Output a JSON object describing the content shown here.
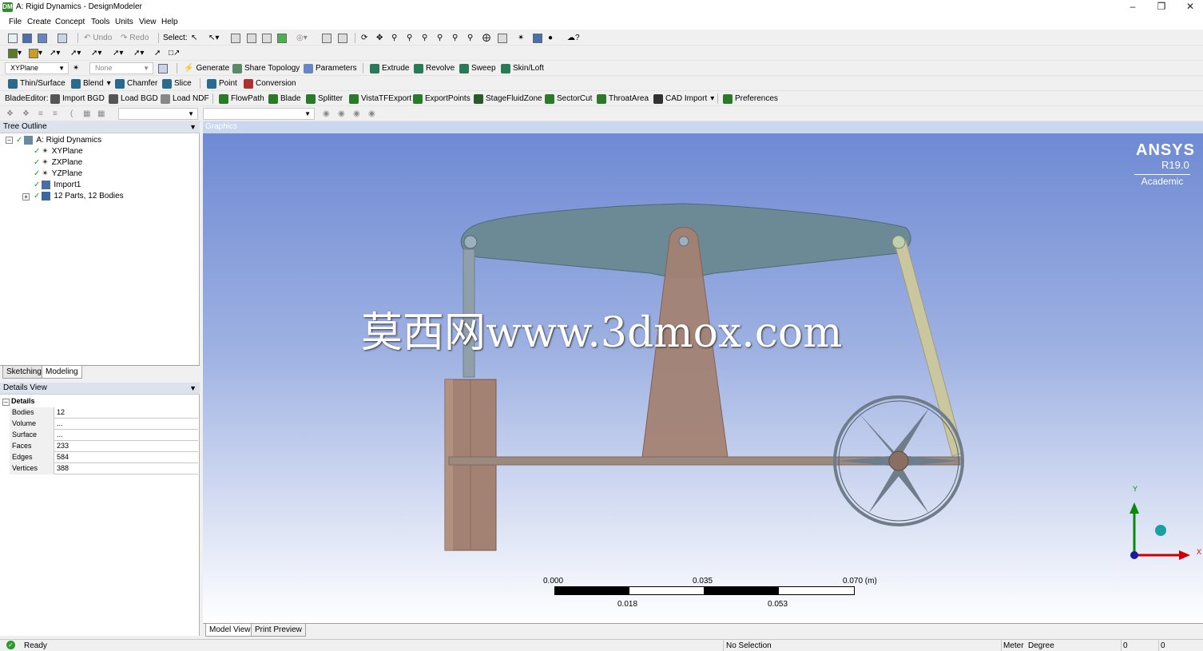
{
  "window": {
    "title": "A: Rigid Dynamics - DesignModeler",
    "app_icon": "DM"
  },
  "menu": [
    "File",
    "Create",
    "Concept",
    "Tools",
    "Units",
    "View",
    "Help"
  ],
  "toolbar1": {
    "undo": "Undo",
    "redo": "Redo",
    "select": "Select:"
  },
  "toolbar3": {
    "plane": "XYPlane",
    "sketch": "None",
    "generate": "Generate",
    "share_topology": "Share Topology",
    "parameters": "Parameters",
    "extrude": "Extrude",
    "revolve": "Revolve",
    "sweep": "Sweep",
    "skin_loft": "Skin/Loft"
  },
  "toolbar4": {
    "thin_surface": "Thin/Surface",
    "blend": "Blend",
    "chamfer": "Chamfer",
    "slice": "Slice",
    "point": "Point",
    "conversion": "Conversion"
  },
  "toolbar5": {
    "blade_editor": "BladeEditor:",
    "import_bgd": "Import BGD",
    "load_bgd": "Load BGD",
    "load_ndf": "Load NDF",
    "flowpath": "FlowPath",
    "blade": "Blade",
    "splitter": "Splitter",
    "vista_tf_export": "VistaTFExport",
    "export_points": "ExportPoints",
    "stage_fluid_zone": "StageFluidZone",
    "sector_cut": "SectorCut",
    "throat_area": "ThroatArea",
    "cad_import": "CAD Import",
    "preferences": "Preferences"
  },
  "tree_outline": {
    "title": "Tree Outline",
    "root": "A: Rigid Dynamics",
    "items": [
      "XYPlane",
      "ZXPlane",
      "YZPlane",
      "Import1",
      "12 Parts, 12 Bodies"
    ]
  },
  "panel_tabs": [
    "Sketching",
    "Modeling"
  ],
  "details_view": {
    "title": "Details View",
    "group": "Details",
    "rows": [
      {
        "k": "Bodies",
        "v": "12"
      },
      {
        "k": "Volume",
        "v": "..."
      },
      {
        "k": "Surface Area",
        "v": "..."
      },
      {
        "k": "Faces",
        "v": "233"
      },
      {
        "k": "Edges",
        "v": "584"
      },
      {
        "k": "Vertices",
        "v": "388"
      }
    ]
  },
  "graphics": {
    "title": "Graphics",
    "brand": "ANSYS",
    "version": "R19.0",
    "edition": "Academic",
    "watermark": "莫西网www.3dmox.com",
    "scale": {
      "top": [
        "0.000",
        "0.035",
        "0.070 (m)"
      ],
      "bottom": [
        "0.018",
        "0.053"
      ]
    },
    "axes": {
      "x": "X",
      "y": "Y"
    },
    "tabs": [
      "Model View",
      "Print Preview"
    ]
  },
  "status": {
    "state": "Ready",
    "selection": "No Selection",
    "length_unit": "Meter",
    "angle_unit": "Degree",
    "v1": "0",
    "v2": "0"
  },
  "colors": {
    "beam": "#6c8a96",
    "post": "#a38273",
    "rod": "#9c8a80",
    "wheel": "#6f7d8a",
    "link": "#c9c6a0",
    "accent_green": "#2a9a2a"
  }
}
